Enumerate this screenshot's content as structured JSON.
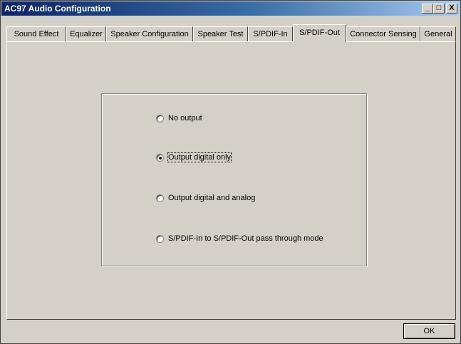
{
  "window": {
    "title": "AC97 Audio Configuration"
  },
  "titlebar_buttons": {
    "minimize": "_",
    "maximize": "□",
    "close": "X"
  },
  "tabs": [
    {
      "label": "Sound Effect"
    },
    {
      "label": "Equalizer"
    },
    {
      "label": "Speaker Configuration"
    },
    {
      "label": "Speaker Test"
    },
    {
      "label": "S/PDIF-In"
    },
    {
      "label": "S/PDIF-Out"
    },
    {
      "label": "Connector Sensing"
    },
    {
      "label": "General"
    }
  ],
  "active_tab": "S/PDIF-Out",
  "options": [
    {
      "label": "No output",
      "selected": false
    },
    {
      "label": "Output digital only",
      "selected": true
    },
    {
      "label": "Output digital and analog",
      "selected": false
    },
    {
      "label": "S/PDIF-In to S/PDIF-Out pass through mode",
      "selected": false
    }
  ],
  "ok_label": "OK"
}
